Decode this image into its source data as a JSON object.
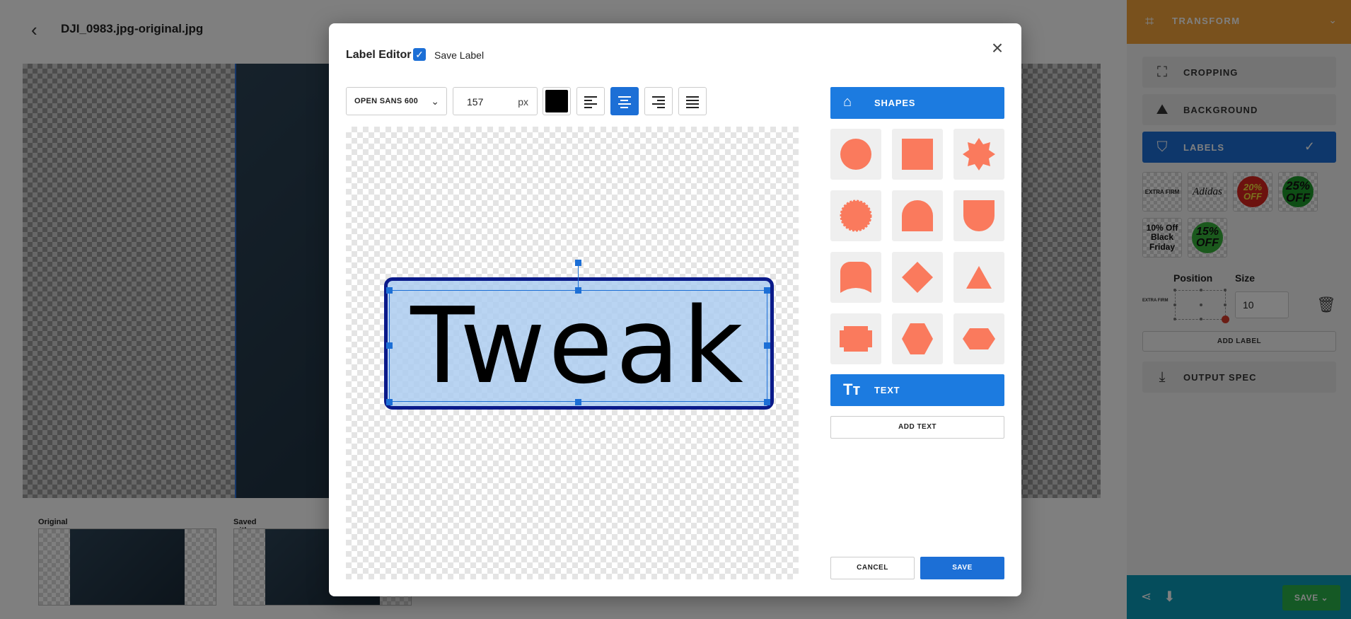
{
  "app": {
    "file_title": "DJI_0983.jpg-original.jpg",
    "thumbs": [
      {
        "label": "Original"
      },
      {
        "label": "Saved with Label"
      }
    ]
  },
  "right_panel": {
    "transform_label": "TRANSFORM",
    "items": [
      {
        "label": "CROPPING",
        "icon": "crop-grid-icon"
      },
      {
        "label": "BACKGROUND",
        "icon": "image-icon"
      },
      {
        "label": "LABELS",
        "icon": "bookmark-icon"
      },
      {
        "label": "OUTPUT SPEC",
        "icon": "download-box-icon"
      }
    ],
    "label_thumbs": [
      {
        "text": "EXTRA FIRM"
      },
      {
        "text": "Adidas"
      },
      {
        "text": "20% OFF"
      },
      {
        "text": "25% OFF"
      },
      {
        "text": "10% Off Black Friday"
      },
      {
        "text": "15% OFF"
      }
    ],
    "position_label": "Position",
    "size_label": "Size",
    "position_thumb_text": "EXTRA FIRM",
    "size_value": "10",
    "add_label": "ADD LABEL",
    "save_label": "SAVE"
  },
  "modal": {
    "title": "Label Editor",
    "save_label_text": "Save Label",
    "save_label_checked": true,
    "font_family": "OPEN SANS 600",
    "font_size": "157",
    "font_unit": "px",
    "text_color": "#000000",
    "alignment_selected": "center",
    "label_text": "Tweak",
    "shape_fill": "#adcdf0",
    "shape_border": "#0a1a8a",
    "shapes_label": "SHAPES",
    "text_label": "TEXT",
    "add_text_label": "ADD TEXT",
    "cancel_label": "CANCEL",
    "save_label": "SAVE",
    "shape_color": "#fa7a5d",
    "shapes": [
      "circle",
      "square",
      "star-burst",
      "scalloped-circle",
      "arch",
      "shield",
      "bookmark-arch",
      "diamond",
      "triangle",
      "notched-rectangle",
      "hexagon",
      "horizontal-hexagon"
    ]
  }
}
